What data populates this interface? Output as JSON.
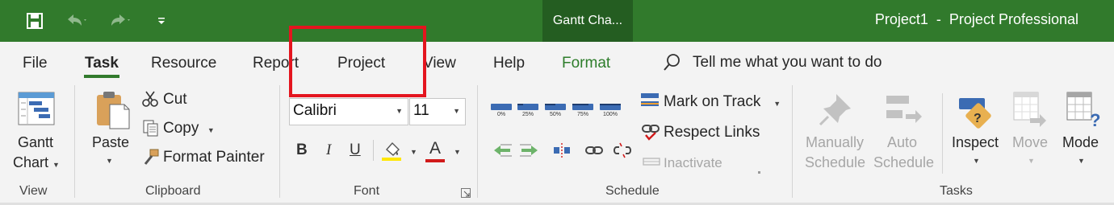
{
  "title_bar": {
    "context_tab": "Gantt Cha...",
    "app_title": "Project1  -  Project Professional"
  },
  "tabs": [
    {
      "label": "File"
    },
    {
      "label": "Task"
    },
    {
      "label": "Resource"
    },
    {
      "label": "Report"
    },
    {
      "label": "Project"
    },
    {
      "label": "View"
    },
    {
      "label": "Help"
    },
    {
      "label": "Format"
    }
  ],
  "tell_me": "Tell me what you want to do",
  "groups": {
    "view": {
      "label": "View",
      "gantt_line1": "Gantt",
      "gantt_line2": "Chart"
    },
    "clipboard": {
      "label": "Clipboard",
      "paste": "Paste",
      "cut": "Cut",
      "copy": "Copy",
      "format_painter": "Format Painter"
    },
    "font": {
      "label": "Font",
      "font_name": "Calibri",
      "font_size": "11",
      "bold": "B",
      "italic": "I",
      "underline": "U",
      "font_color_letter": "A"
    },
    "schedule": {
      "label": "Schedule",
      "percents": [
        "0%",
        "25%",
        "50%",
        "75%",
        "100%"
      ],
      "mark_on_track": "Mark on Track",
      "respect_links": "Respect Links",
      "inactivate": "Inactivate"
    },
    "tasks": {
      "label": "Tasks",
      "manually_1": "Manually",
      "manually_2": "Schedule",
      "auto_1": "Auto",
      "auto_2": "Schedule",
      "inspect": "Inspect",
      "move": "Move",
      "mode": "Mode"
    }
  },
  "colors": {
    "title_bar": "#317a2c",
    "context_tab": "#245d21",
    "highlight_box": "#e4151f",
    "underline_accent": "#317a2c",
    "highlight_yellow": "#ffe600",
    "font_red": "#d11a1a"
  }
}
